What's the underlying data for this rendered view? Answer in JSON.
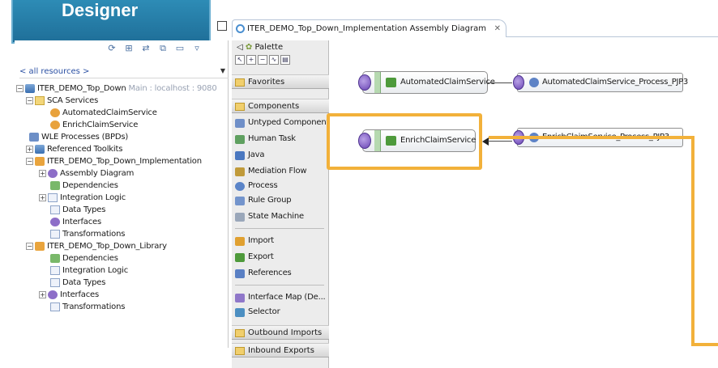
{
  "badge": {
    "title": "Designer"
  },
  "left_panel": {
    "toolbar_icons": [
      "sync-icon",
      "grid-icon",
      "link-icon",
      "filter-icon",
      "collapse-icon",
      "view-menu-icon"
    ],
    "filter": "< all resources >",
    "tree": [
      {
        "label": "ITER_DEMO_Top_Down",
        "suffix": "Main : localhost : 9080",
        "icon": "project-icon"
      },
      {
        "label": "SCA Services",
        "icon": "folder-icon"
      },
      {
        "label": "AutomatedClaimService",
        "icon": "service-icon"
      },
      {
        "label": "EnrichClaimService",
        "icon": "service-icon"
      },
      {
        "label": "WLE Processes (BPDs)",
        "icon": "process-icon"
      },
      {
        "label": "Referenced Toolkits",
        "icon": "toolkit-icon"
      },
      {
        "label": "ITER_DEMO_Top_Down_Implementation",
        "icon": "module-icon"
      },
      {
        "label": "Assembly Diagram",
        "icon": "assembly-icon"
      },
      {
        "label": "Dependencies",
        "icon": "dependencies-icon"
      },
      {
        "label": "Integration Logic",
        "icon": "logic-icon"
      },
      {
        "label": "Data Types",
        "icon": "datatypes-icon"
      },
      {
        "label": "Interfaces",
        "icon": "interface-icon"
      },
      {
        "label": "Transformations",
        "icon": "transform-icon"
      },
      {
        "label": "ITER_DEMO_Top_Down_Library",
        "icon": "library-icon"
      },
      {
        "label": "Dependencies",
        "icon": "dependencies-icon"
      },
      {
        "label": "Integration Logic",
        "icon": "logic-icon"
      },
      {
        "label": "Data Types",
        "icon": "datatypes-icon"
      },
      {
        "label": "Interfaces",
        "icon": "interface-icon"
      },
      {
        "label": "Transformations",
        "icon": "transform-icon"
      }
    ]
  },
  "editor": {
    "tab_label": "ITER_DEMO_Top_Down_Implementation  Assembly Diagram",
    "close_glyph": "✕"
  },
  "palette": {
    "header": "Palette",
    "drawers": {
      "favorites": "Favorites",
      "components": "Components",
      "outbound_imports": "Outbound Imports",
      "inbound_exports": "Inbound Exports"
    },
    "component_items": [
      "Untyped Component",
      "Human Task",
      "Java",
      "Mediation Flow",
      "Process",
      "Rule Group",
      "State Machine"
    ],
    "wiring_items": [
      "Import",
      "Export",
      "References"
    ],
    "misc_items": [
      "Interface Map (De...",
      "Selector"
    ]
  },
  "canvas": {
    "components": [
      {
        "label": "AutomatedClaimService"
      },
      {
        "label": "EnrichClaimService"
      }
    ],
    "imports": [
      {
        "label": "AutomatedClaimService_Process_PJP3"
      },
      {
        "label": "EnrichClaimService_Process_PJP3"
      }
    ]
  },
  "colors": {
    "highlight": "#f2b13a",
    "badge": "#1f6f99"
  }
}
